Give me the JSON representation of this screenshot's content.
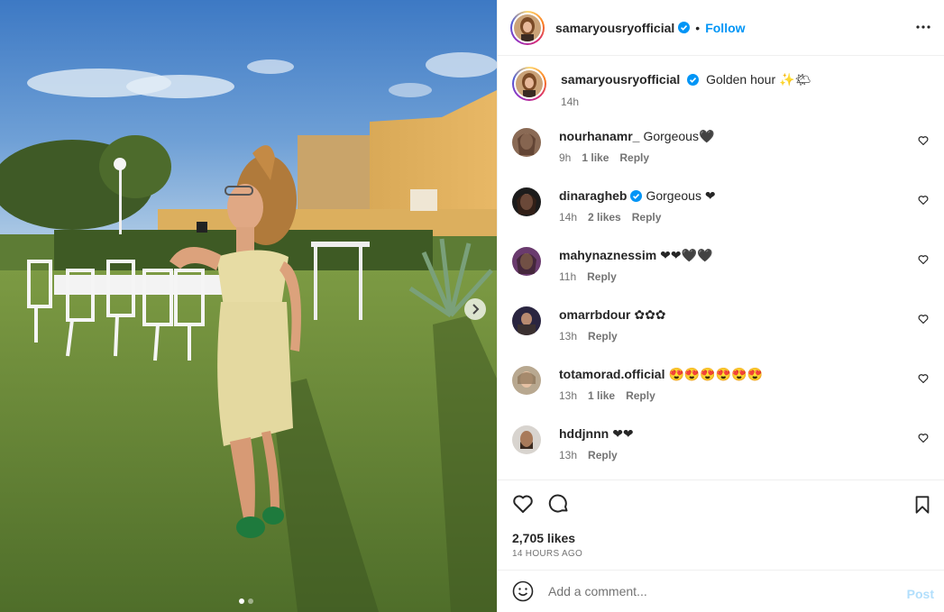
{
  "post_author": {
    "username": "samaryousryofficial",
    "verified": true,
    "follow_label": "Follow",
    "separator": "•"
  },
  "caption": {
    "username": "samaryousryofficial",
    "text": "Golden hour ✨🌤",
    "time": "14h"
  },
  "comments": [
    {
      "username": "nourhanamr_",
      "text": "Gorgeous🖤",
      "time": "9h",
      "likes": "1 like",
      "reply": "Reply",
      "verified": false
    },
    {
      "username": "dinaragheb",
      "text": "Gorgeous ❤",
      "time": "14h",
      "likes": "2 likes",
      "reply": "Reply",
      "verified": true
    },
    {
      "username": "mahynaznessim",
      "text": "❤❤🖤🖤",
      "time": "11h",
      "likes": "",
      "reply": "Reply",
      "verified": false
    },
    {
      "username": "omarrbdour",
      "text": "✿✿✿",
      "time": "13h",
      "likes": "",
      "reply": "Reply",
      "verified": false
    },
    {
      "username": "totamorad.official",
      "text": "😍😍😍😍😍😍",
      "time": "13h",
      "likes": "1 like",
      "reply": "Reply",
      "verified": false
    },
    {
      "username": "hddjnnn",
      "text": "❤❤",
      "time": "13h",
      "likes": "",
      "reply": "Reply",
      "verified": false
    }
  ],
  "stats": {
    "likes": "2,705 likes",
    "timestamp": "14 HOURS AGO"
  },
  "composer": {
    "placeholder": "Add a comment...",
    "post_label": "Post"
  },
  "carousel": {
    "slide_count": 2,
    "active_index": 0
  },
  "colors": {
    "accent": "#0095f6",
    "verified": "#0095f6",
    "muted": "#737373",
    "post_disabled": "#b2dffc",
    "divider": "#efefef"
  },
  "icons": [
    "verified-badge-icon",
    "more-options-icon",
    "heart-icon",
    "comment-icon",
    "bookmark-icon",
    "emoji-icon",
    "chevron-right-icon"
  ]
}
